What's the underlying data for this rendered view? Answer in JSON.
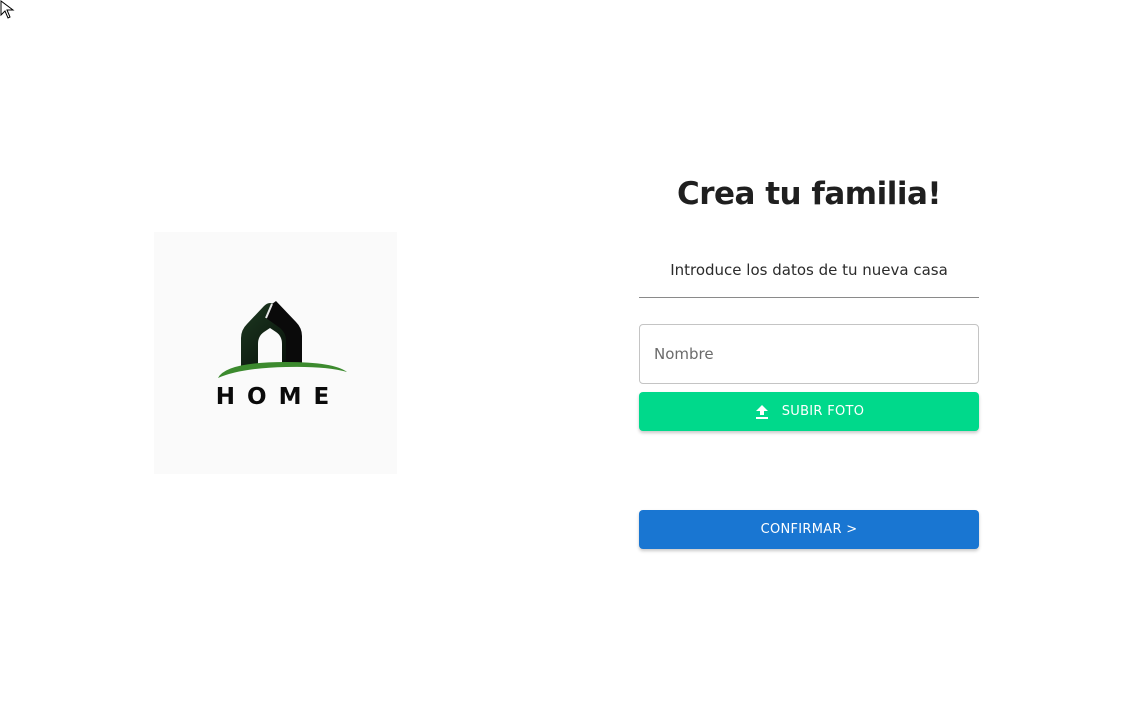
{
  "logo": {
    "wordmark": "HOME"
  },
  "form": {
    "title": "Crea tu familia!",
    "subtitle": "Introduce los datos de tu nueva casa",
    "name_placeholder": "Nombre",
    "name_value": "",
    "upload_label": "SUBIR FOTO",
    "confirm_label": "CONFIRMAR >"
  },
  "colors": {
    "upload_button": "#00d98b",
    "confirm_button": "#1976d2",
    "logo_green": "#3c8a2e",
    "logo_dark": "#0f2414"
  },
  "icons": {
    "upload": "upload-icon",
    "cursor": "mouse-pointer-icon"
  }
}
